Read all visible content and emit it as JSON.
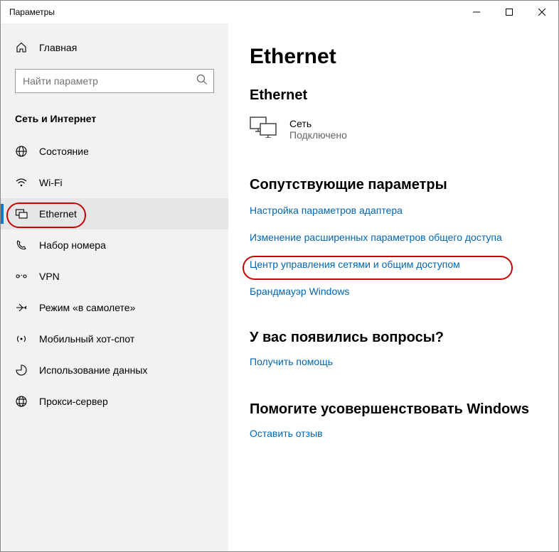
{
  "window": {
    "title": "Параметры"
  },
  "sidebar": {
    "home": "Главная",
    "search_placeholder": "Найти параметр",
    "section": "Сеть и Интернет",
    "items": [
      {
        "label": "Состояние"
      },
      {
        "label": "Wi-Fi"
      },
      {
        "label": "Ethernet"
      },
      {
        "label": "Набор номера"
      },
      {
        "label": "VPN"
      },
      {
        "label": "Режим «в самолете»"
      },
      {
        "label": "Мобильный хот-спот"
      },
      {
        "label": "Использование данных"
      },
      {
        "label": "Прокси-сервер"
      }
    ]
  },
  "main": {
    "title": "Ethernet",
    "subtitle": "Ethernet",
    "network": {
      "name": "Сеть",
      "state": "Подключено"
    },
    "related": {
      "heading": "Сопутствующие параметры",
      "links": [
        "Настройка параметров адаптера",
        "Изменение расширенных параметров общего доступа",
        "Центр управления сетями и общим доступом",
        "Брандмауэр Windows"
      ]
    },
    "questions": {
      "heading": "У вас появились вопросы?",
      "link": "Получить помощь"
    },
    "improve": {
      "heading": "Помогите усовершенствовать Windows",
      "link": "Оставить отзыв"
    }
  }
}
